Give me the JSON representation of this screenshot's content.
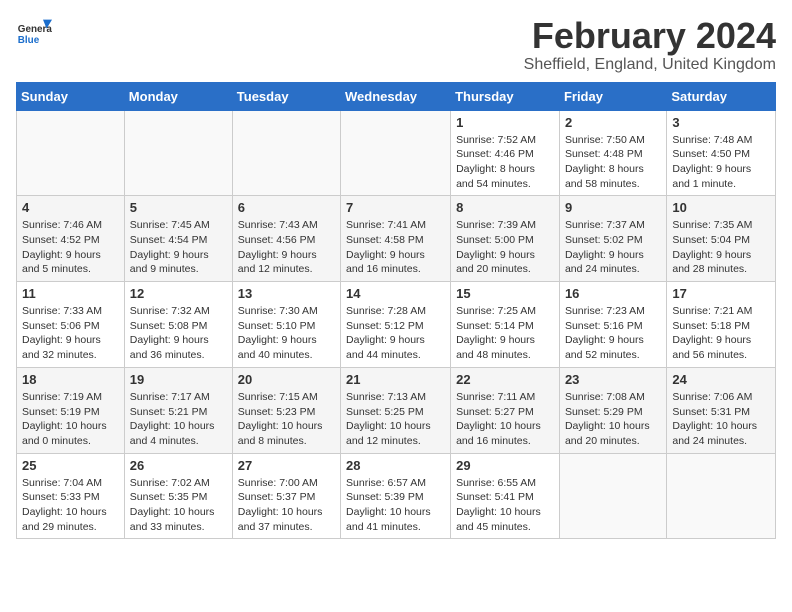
{
  "header": {
    "logo_general": "General",
    "logo_blue": "Blue",
    "month_title": "February 2024",
    "location": "Sheffield, England, United Kingdom"
  },
  "calendar": {
    "days_of_week": [
      "Sunday",
      "Monday",
      "Tuesday",
      "Wednesday",
      "Thursday",
      "Friday",
      "Saturday"
    ],
    "weeks": [
      [
        {
          "day": "",
          "info": ""
        },
        {
          "day": "",
          "info": ""
        },
        {
          "day": "",
          "info": ""
        },
        {
          "day": "",
          "info": ""
        },
        {
          "day": "1",
          "info": "Sunrise: 7:52 AM\nSunset: 4:46 PM\nDaylight: 8 hours\nand 54 minutes."
        },
        {
          "day": "2",
          "info": "Sunrise: 7:50 AM\nSunset: 4:48 PM\nDaylight: 8 hours\nand 58 minutes."
        },
        {
          "day": "3",
          "info": "Sunrise: 7:48 AM\nSunset: 4:50 PM\nDaylight: 9 hours\nand 1 minute."
        }
      ],
      [
        {
          "day": "4",
          "info": "Sunrise: 7:46 AM\nSunset: 4:52 PM\nDaylight: 9 hours\nand 5 minutes."
        },
        {
          "day": "5",
          "info": "Sunrise: 7:45 AM\nSunset: 4:54 PM\nDaylight: 9 hours\nand 9 minutes."
        },
        {
          "day": "6",
          "info": "Sunrise: 7:43 AM\nSunset: 4:56 PM\nDaylight: 9 hours\nand 12 minutes."
        },
        {
          "day": "7",
          "info": "Sunrise: 7:41 AM\nSunset: 4:58 PM\nDaylight: 9 hours\nand 16 minutes."
        },
        {
          "day": "8",
          "info": "Sunrise: 7:39 AM\nSunset: 5:00 PM\nDaylight: 9 hours\nand 20 minutes."
        },
        {
          "day": "9",
          "info": "Sunrise: 7:37 AM\nSunset: 5:02 PM\nDaylight: 9 hours\nand 24 minutes."
        },
        {
          "day": "10",
          "info": "Sunrise: 7:35 AM\nSunset: 5:04 PM\nDaylight: 9 hours\nand 28 minutes."
        }
      ],
      [
        {
          "day": "11",
          "info": "Sunrise: 7:33 AM\nSunset: 5:06 PM\nDaylight: 9 hours\nand 32 minutes."
        },
        {
          "day": "12",
          "info": "Sunrise: 7:32 AM\nSunset: 5:08 PM\nDaylight: 9 hours\nand 36 minutes."
        },
        {
          "day": "13",
          "info": "Sunrise: 7:30 AM\nSunset: 5:10 PM\nDaylight: 9 hours\nand 40 minutes."
        },
        {
          "day": "14",
          "info": "Sunrise: 7:28 AM\nSunset: 5:12 PM\nDaylight: 9 hours\nand 44 minutes."
        },
        {
          "day": "15",
          "info": "Sunrise: 7:25 AM\nSunset: 5:14 PM\nDaylight: 9 hours\nand 48 minutes."
        },
        {
          "day": "16",
          "info": "Sunrise: 7:23 AM\nSunset: 5:16 PM\nDaylight: 9 hours\nand 52 minutes."
        },
        {
          "day": "17",
          "info": "Sunrise: 7:21 AM\nSunset: 5:18 PM\nDaylight: 9 hours\nand 56 minutes."
        }
      ],
      [
        {
          "day": "18",
          "info": "Sunrise: 7:19 AM\nSunset: 5:19 PM\nDaylight: 10 hours\nand 0 minutes."
        },
        {
          "day": "19",
          "info": "Sunrise: 7:17 AM\nSunset: 5:21 PM\nDaylight: 10 hours\nand 4 minutes."
        },
        {
          "day": "20",
          "info": "Sunrise: 7:15 AM\nSunset: 5:23 PM\nDaylight: 10 hours\nand 8 minutes."
        },
        {
          "day": "21",
          "info": "Sunrise: 7:13 AM\nSunset: 5:25 PM\nDaylight: 10 hours\nand 12 minutes."
        },
        {
          "day": "22",
          "info": "Sunrise: 7:11 AM\nSunset: 5:27 PM\nDaylight: 10 hours\nand 16 minutes."
        },
        {
          "day": "23",
          "info": "Sunrise: 7:08 AM\nSunset: 5:29 PM\nDaylight: 10 hours\nand 20 minutes."
        },
        {
          "day": "24",
          "info": "Sunrise: 7:06 AM\nSunset: 5:31 PM\nDaylight: 10 hours\nand 24 minutes."
        }
      ],
      [
        {
          "day": "25",
          "info": "Sunrise: 7:04 AM\nSunset: 5:33 PM\nDaylight: 10 hours\nand 29 minutes."
        },
        {
          "day": "26",
          "info": "Sunrise: 7:02 AM\nSunset: 5:35 PM\nDaylight: 10 hours\nand 33 minutes."
        },
        {
          "day": "27",
          "info": "Sunrise: 7:00 AM\nSunset: 5:37 PM\nDaylight: 10 hours\nand 37 minutes."
        },
        {
          "day": "28",
          "info": "Sunrise: 6:57 AM\nSunset: 5:39 PM\nDaylight: 10 hours\nand 41 minutes."
        },
        {
          "day": "29",
          "info": "Sunrise: 6:55 AM\nSunset: 5:41 PM\nDaylight: 10 hours\nand 45 minutes."
        },
        {
          "day": "",
          "info": ""
        },
        {
          "day": "",
          "info": ""
        }
      ]
    ]
  }
}
